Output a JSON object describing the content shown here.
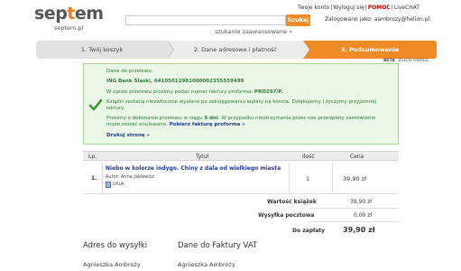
{
  "header": {
    "logo_prefix": "sep",
    "logo_o": "t",
    "logo_suffix": "em",
    "logo_sub": "septem.pl",
    "links": {
      "contact": "Twoje konto",
      "logout": "Wyloguj się",
      "help": "POMOC",
      "chat": "LiveCHAT"
    },
    "search_placeholder": "",
    "search_button": "Szukaj",
    "search_advanced": "szukanie zaawansowane »",
    "logged_label": "Zalogowano jako: aambrozy@helion.pl"
  },
  "steps": [
    {
      "label": "1. Twój koszyk"
    },
    {
      "label": "2. Dane adresowe i płatność"
    },
    {
      "label": "3. Podsumowanie"
    }
  ],
  "beta": {
    "badge": "BETA",
    "text": "ZGŁOŚ UWAGĘ"
  },
  "panel": {
    "line1": "Dane do przelewu:",
    "line2": "ING Bank Śląski, 64105012981000002355559499",
    "line3_pre": "W opisie przelewu prosimy podać numer faktury proforma:",
    "line3_num": "PRO297/P.",
    "line4": "Książki zostaną niezwłocznie wysłane po zaksięgowaniu wpłaty na koncie. Dziękujemy i życzymy przyjemnej",
    "line5": "lektury.",
    "line6_pre": "Prosimy o dokonanie przelewu w ciągu",
    "line6_days": "5 dni",
    "line6_post": ". W przypadku nieotrzymania przez nas przedpłaty zamówienie",
    "line7_pre": "może zostać anulowane.",
    "line7_link": "Pobierz fakturę proforma »",
    "print_link": "Drukuj stronę »"
  },
  "table": {
    "headers": {
      "lp": "Lp.",
      "title": "Tytuł",
      "qty": "Ilość",
      "price": "Cena"
    },
    "rows": [
      {
        "lp": "1.",
        "title": "Niebo w kolorze indygo. Chiny z dala od wielkiego miasta",
        "author": "Autor: Anna Jaklewicz",
        "format": "DRUK",
        "qty": "1",
        "price": "39,90 zł"
      }
    ],
    "summary": {
      "books_label": "Wartość książek",
      "books_value": "39,90 zł",
      "shipping_label": "Wysyłka pocztowa",
      "shipping_value": "0,00 zł",
      "total_label": "Do zapłaty",
      "total_value": "39,90 zł"
    }
  },
  "addresses": {
    "shipping_heading": "Adres do wysyłki",
    "invoice_heading": "Dane do Faktury VAT",
    "shipping_name": "Agnieszka Ambroży",
    "invoice_name": "Agnieszka Ambroży"
  },
  "colors": {
    "accent": "#f08a24",
    "link": "#1f3a93",
    "panel_bg": "#ecf8e7",
    "panel_text": "#2d7a39"
  }
}
